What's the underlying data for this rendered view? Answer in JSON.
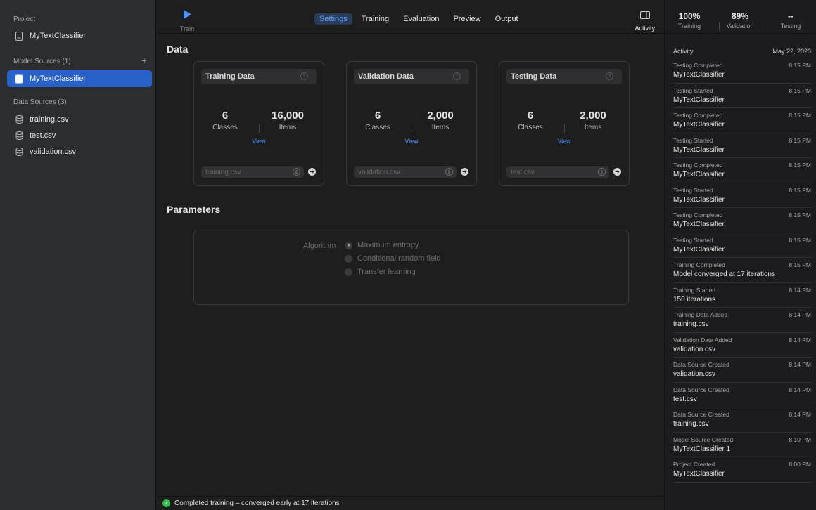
{
  "sidebar": {
    "project_title": "Project",
    "project_name": "MyTextClassifier",
    "model_sources_title": "Model Sources (1)",
    "model_selected": "MyTextClassifier",
    "data_sources_title": "Data Sources (3)",
    "data_sources": [
      "training.csv",
      "test.csv",
      "validation.csv"
    ]
  },
  "toolbar": {
    "train_label": "Train",
    "tabs": [
      "Settings",
      "Training",
      "Evaluation",
      "Preview",
      "Output"
    ],
    "active_tab": "Settings",
    "activity_label": "Activity"
  },
  "main": {
    "data_title": "Data",
    "cards": [
      {
        "title": "Training Data",
        "classes": "6",
        "classes_label": "Classes",
        "items": "16,000",
        "items_label": "Items",
        "view": "View",
        "file": "training.csv"
      },
      {
        "title": "Validation Data",
        "classes": "6",
        "classes_label": "Classes",
        "items": "2,000",
        "items_label": "Items",
        "view": "View",
        "file": "validation.csv"
      },
      {
        "title": "Testing Data",
        "classes": "6",
        "classes_label": "Classes",
        "items": "2,000",
        "items_label": "Items",
        "view": "View",
        "file": "test.csv"
      }
    ],
    "parameters_title": "Parameters",
    "algorithm_label": "Algorithm",
    "algorithms": [
      "Maximum entropy",
      "Conditional random field",
      "Transfer learning"
    ],
    "selected_algorithm": "Maximum entropy"
  },
  "status": {
    "message": "Completed training – converged early at 17 iterations"
  },
  "activity": {
    "metrics": [
      {
        "value": "100%",
        "label": "Training"
      },
      {
        "value": "89%",
        "label": "Validation"
      },
      {
        "value": "--",
        "label": "Testing"
      }
    ],
    "header_title": "Activity",
    "header_date": "May 22, 2023",
    "items": [
      {
        "type": "Testing Completed",
        "subject": "MyTextClassifier",
        "time": "8:15 PM"
      },
      {
        "type": "Testing Started",
        "subject": "MyTextClassifier",
        "time": "8:15 PM"
      },
      {
        "type": "Testing Completed",
        "subject": "MyTextClassifier",
        "time": "8:15 PM"
      },
      {
        "type": "Testing Started",
        "subject": "MyTextClassifier",
        "time": "8:15 PM"
      },
      {
        "type": "Testing Completed",
        "subject": "MyTextClassifier",
        "time": "8:15 PM"
      },
      {
        "type": "Testing Started",
        "subject": "MyTextClassifier",
        "time": "8:15 PM"
      },
      {
        "type": "Testing Completed",
        "subject": "MyTextClassifier",
        "time": "8:15 PM"
      },
      {
        "type": "Testing Started",
        "subject": "MyTextClassifier",
        "time": "8:15 PM"
      },
      {
        "type": "Training Completed",
        "subject": "Model converged at 17 iterations",
        "time": "8:15 PM"
      },
      {
        "type": "Training Started",
        "subject": "150 iterations",
        "time": "8:14 PM"
      },
      {
        "type": "Training Data Added",
        "subject": "training.csv",
        "time": "8:14 PM"
      },
      {
        "type": "Validation Data Added",
        "subject": "validation.csv",
        "time": "8:14 PM"
      },
      {
        "type": "Data Source Created",
        "subject": "validation.csv",
        "time": "8:14 PM"
      },
      {
        "type": "Data Source Created",
        "subject": "test.csv",
        "time": "8:14 PM"
      },
      {
        "type": "Data Source Created",
        "subject": "training.csv",
        "time": "8:14 PM"
      },
      {
        "type": "Model Source Created",
        "subject": "MyTextClassifier 1",
        "time": "8:10 PM"
      },
      {
        "type": "Project Created",
        "subject": "MyTextClassifier",
        "time": "8:00 PM"
      }
    ]
  },
  "colors": {
    "accent": "#2862c8",
    "link": "#4f93ff",
    "success": "#30c04f"
  }
}
